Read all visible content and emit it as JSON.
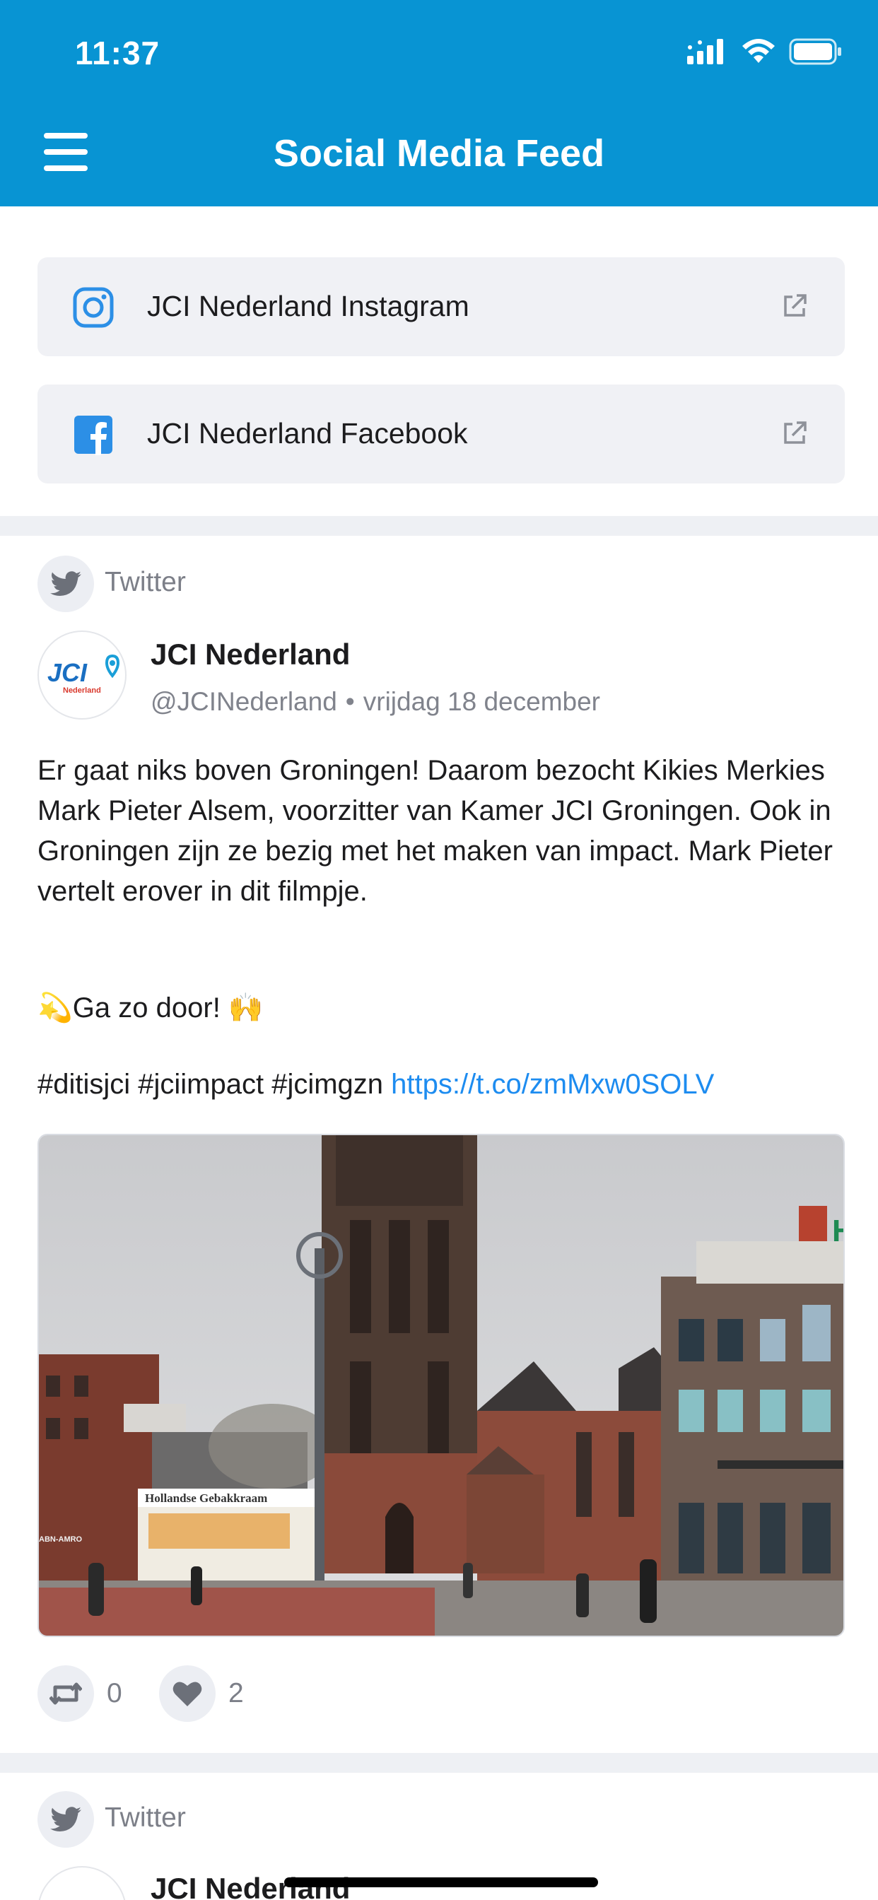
{
  "status": {
    "time": "11:37"
  },
  "header": {
    "title": "Social Media Feed"
  },
  "links": [
    {
      "label": "JCI Nederland Instagram",
      "icon": "instagram-icon"
    },
    {
      "label": "JCI Nederland Facebook",
      "icon": "facebook-icon"
    }
  ],
  "posts": [
    {
      "source": "Twitter",
      "author": "JCI Nederland",
      "handle": "@JCINederland",
      "date": "vrijdag 18 december",
      "text": "Er gaat niks boven Groningen! Daarom bezocht Kikies Merkies Mark Pieter Alsem, voorzitter van Kamer JCI Groningen. Ook in Groningen zijn ze bezig met het maken van impact. Mark Pieter vertelt erover in dit filmpje.",
      "cheer": "💫Ga zo door! 🙌",
      "hashtags": "#ditisjci #jciimpact #jcimgzn ",
      "link": "https://t.co/zmMxw0SOLV",
      "avatar_text": "JCI",
      "avatar_sub": "Nederland",
      "media_signs": {
        "bakery": "Hollandse Gebakkraam",
        "bank": "ABN-AMRO",
        "hotel": "HO"
      },
      "retweets": "0",
      "likes": "2"
    },
    {
      "source": "Twitter",
      "author": "JCI Nederland"
    }
  ],
  "colors": {
    "brand": "#0894d3",
    "link": "#1d8cf0",
    "card": "#f0f1f5"
  }
}
